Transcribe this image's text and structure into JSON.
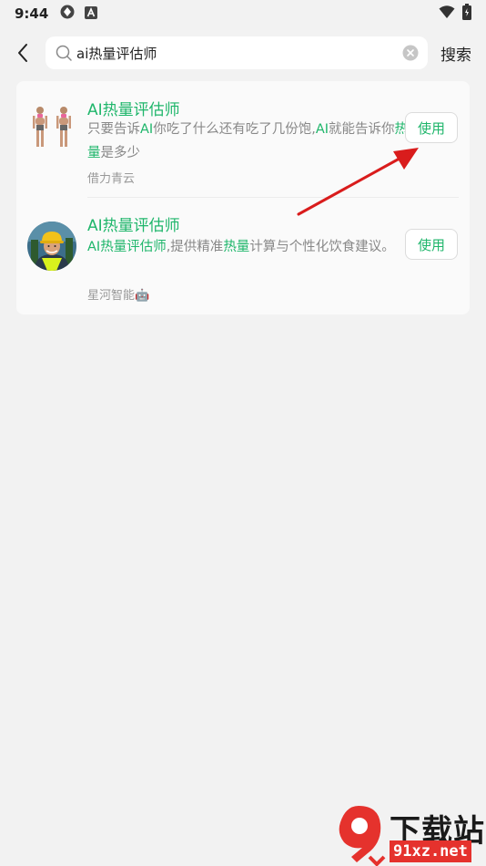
{
  "status_bar": {
    "time": "9:44",
    "icons": [
      "vpn-icon",
      "a-icon",
      "wifi-icon",
      "battery-icon"
    ]
  },
  "header": {
    "search_value": "ai热量评估师",
    "search_action": "搜索"
  },
  "results": [
    {
      "title": "AI热量评估师",
      "desc_parts": [
        {
          "text": "只要告诉",
          "hl": false
        },
        {
          "text": "AI",
          "hl": true
        },
        {
          "text": "你吃了什么还有吃了几份饱,",
          "hl": false
        },
        {
          "text": "AI",
          "hl": true
        },
        {
          "text": "就能告诉你",
          "hl": false
        },
        {
          "text": "热量",
          "hl": true
        },
        {
          "text": "是多少",
          "hl": false
        }
      ],
      "author": "借力青云",
      "use_label": "使用"
    },
    {
      "title": "AI热量评估师",
      "desc_parts": [
        {
          "text": "AI热量评估师",
          "hl": true
        },
        {
          "text": ",提供精准",
          "hl": false
        },
        {
          "text": "热量",
          "hl": true
        },
        {
          "text": "计算与个性化饮食建议。",
          "hl": false
        }
      ],
      "author": "星河智能🤖",
      "use_label": "使用"
    }
  ],
  "watermark": {
    "logo_text": "下载站",
    "url": "91xz.net"
  },
  "colors": {
    "accent": "#1fb66b",
    "background": "#f2f2f2",
    "arrow": "#d91c1c"
  }
}
